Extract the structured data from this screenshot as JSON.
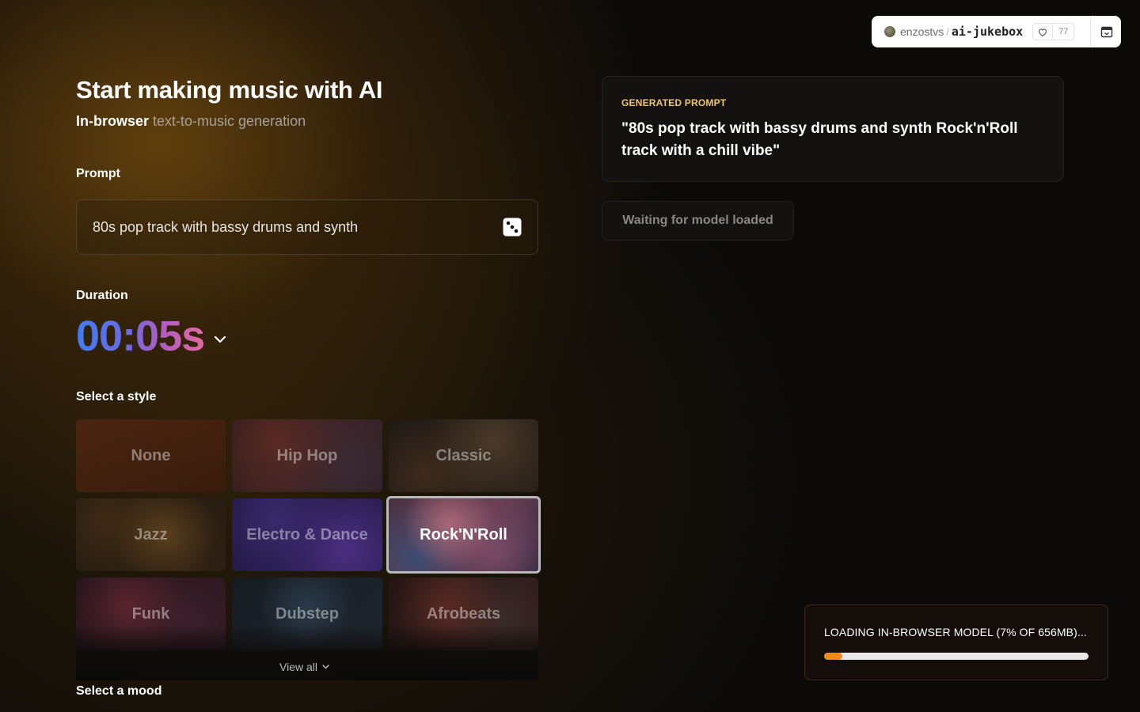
{
  "space": {
    "owner": "enzostvs",
    "separator": "/",
    "name": "ai-jukebox",
    "likes": "77"
  },
  "header": {
    "title": "Start making music with AI",
    "subtitle_bold": "In-browser",
    "subtitle_rest": " text-to-music generation"
  },
  "prompt": {
    "label": "Prompt",
    "value": "80s pop track with bassy drums and synth"
  },
  "duration": {
    "label": "Duration",
    "value": "00:05s"
  },
  "style": {
    "label": "Select a style",
    "items": [
      {
        "label": "None"
      },
      {
        "label": "Hip Hop"
      },
      {
        "label": "Classic"
      },
      {
        "label": "Jazz"
      },
      {
        "label": "Electro & Dance"
      },
      {
        "label": "Rock'N'Roll"
      },
      {
        "label": "Funk"
      },
      {
        "label": "Dubstep"
      },
      {
        "label": "Afrobeats"
      }
    ],
    "selected": "Rock'N'Roll",
    "view_all": "View all"
  },
  "mood": {
    "label": "Select a mood"
  },
  "generated": {
    "label": "GENERATED PROMPT",
    "text": "\"80s pop track with bassy drums and synth Rock'n'Roll track with a chill vibe\""
  },
  "status_button": "Waiting for model loaded",
  "loader": {
    "text": "LOADING IN-BROWSER MODEL (7% OF 656MB)...",
    "progress": 0.07
  },
  "colors": {
    "accent_orange": "#f28a1a",
    "gen_label": "#f3c56a",
    "duration_gradient": [
      "#3f7cf5",
      "#b65cc0",
      "#e36aa0"
    ]
  }
}
